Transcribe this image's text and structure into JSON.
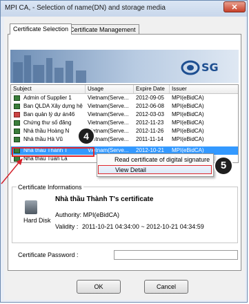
{
  "window": {
    "title": "MPI CA, - Selection of name(DN) and storage media",
    "close_label": "✕"
  },
  "tabs": [
    {
      "label": "Certificate Selection",
      "active": true
    },
    {
      "label": "Certificate Management",
      "active": false
    }
  ],
  "banner": {
    "logo_text": "SG"
  },
  "list": {
    "columns": [
      "Subject",
      "Usage",
      "Expire Date",
      "Issuer"
    ],
    "rows": [
      {
        "subject": "Admin of Supplier 1",
        "usage": "Vietnam(Serve...",
        "expire": "2012-09-05",
        "issuer": "MPI(eBidCA)",
        "icon": "green"
      },
      {
        "subject": "Ban QLDA Xây dựng hệ",
        "usage": "Vietnam(Serve...",
        "expire": "2012-06-08",
        "issuer": "MPI(eBidCA)",
        "icon": "green"
      },
      {
        "subject": "Ban quản lý dự án46",
        "usage": "Vietnam(Serve...",
        "expire": "2012-03-03",
        "issuer": "MPI(eBidCA)",
        "icon": "red"
      },
      {
        "subject": "Chứng thư số đăng",
        "usage": "Vietnam(Serve...",
        "expire": "2012-11-23",
        "issuer": "MPI(eBidCA)",
        "icon": "green"
      },
      {
        "subject": "Nhà thầu Hoàng N",
        "usage": "Vietnam(Serve...",
        "expire": "2012-11-26",
        "issuer": "MPI(eBidCA)",
        "icon": "green"
      },
      {
        "subject": "Nhà thầu Hà Vũ",
        "usage": "Vietnam(Serve...",
        "expire": "2011-11-14",
        "issuer": "MPI(eBidCA)",
        "icon": "green"
      },
      {
        "subject": "Nhà thầu Thành T",
        "usage": "Vietnam(Serve...",
        "expire": "2012-10-21",
        "issuer": "MPI(eBidCA)",
        "icon": "green",
        "selected": true
      },
      {
        "subject": "Nhà thầu Tuấn La",
        "usage": "",
        "expire": "",
        "issuer": "",
        "icon": "green"
      }
    ]
  },
  "context_menu": {
    "items": [
      {
        "label": "Read certificate of digital signature"
      },
      {
        "label": "View Detail",
        "hover": true
      }
    ]
  },
  "badges": {
    "step4": "4",
    "step5": "5"
  },
  "cert_info": {
    "group_title": "Certificate Informations",
    "device_label": "Hard Disk",
    "title": "Nhà thầu Thành T's certificate",
    "authority": "Authority: MPI(eBidCA)",
    "validity_label": "Validity :",
    "validity_value": "2011-10-21 04:34:00 ~ 2012-10-21 04:34:59"
  },
  "password": {
    "label": "Certificate Password :",
    "value": ""
  },
  "buttons": {
    "ok": "OK",
    "cancel": "Cancel"
  },
  "colors": {
    "selection": "#3399ff",
    "highlight_red": "#e0262a",
    "brand_blue": "#1e4f91"
  }
}
